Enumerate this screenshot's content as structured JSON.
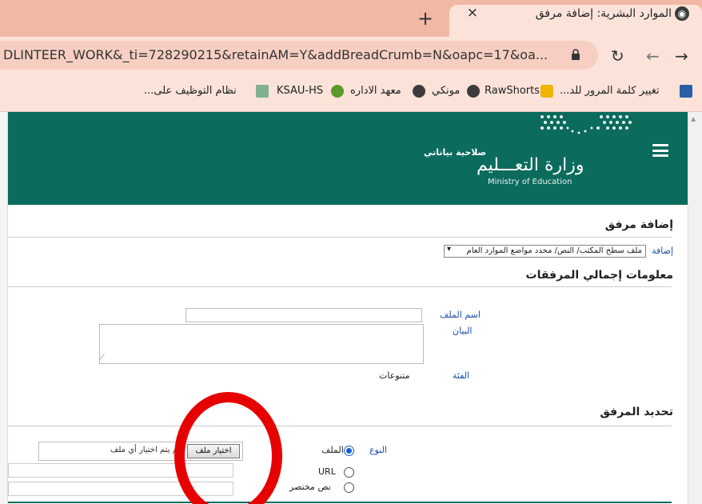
{
  "browser": {
    "tab": {
      "title": "الموارد البشرية: إضافة مرفق",
      "close_label": "×"
    },
    "new_tab_label": "+",
    "url": "DLINTEER_WORK&_ti=728290215&retainAM=Y&addBreadCrumb=N&oapc=17&oa...",
    "nav": {
      "reload": "↻",
      "back": "←",
      "forward": "→"
    },
    "bookmarks": [
      {
        "label": "تغيير كلمة المرور للد...",
        "icon": "building-icon",
        "color": "#2a5fa8"
      },
      {
        "label": "RawShorts",
        "icon": "rawshorts-icon",
        "color": "#f0b400"
      },
      {
        "label": "مونكي",
        "icon": "globe-icon",
        "color": "#3c3c3c"
      },
      {
        "label": "معهد الاداره",
        "icon": "globe-icon",
        "color": "#3c3c3c"
      },
      {
        "label": "KSAU-HS",
        "icon": "ksau-icon",
        "color": "#5a9a2a"
      },
      {
        "label": "نظام التوظيف على...",
        "icon": "emblem-icon",
        "color": "#5a9a6a"
      }
    ]
  },
  "header": {
    "ministry_ar": "وزارة التعـــليم",
    "ministry_en": "Ministry of Education",
    "privilege": "صلاحية بياناتي",
    "brand_color": "#0b6b5c"
  },
  "page": {
    "title": "إضافة مرفق",
    "add_label": "إضافة",
    "add_select_value": "ملف سطح المكتب/ النص/ محدد مواضع الموارد العام",
    "summary_heading": "معلومات إجمالي المرفقات",
    "fields": {
      "filename_label": "اسم الملف",
      "description_label": "البيان",
      "category_label": "الفئة",
      "category_value": "متنوعات"
    },
    "attachment": {
      "heading": "تحديد المرفق",
      "type_label": "النوع",
      "options": {
        "file": "الملف",
        "url": "URL",
        "text": "نص مختصر"
      },
      "selected": "file",
      "choose_file_button": "اختيار ملف",
      "file_status": "لم يتم اختيار أي ملف"
    }
  }
}
